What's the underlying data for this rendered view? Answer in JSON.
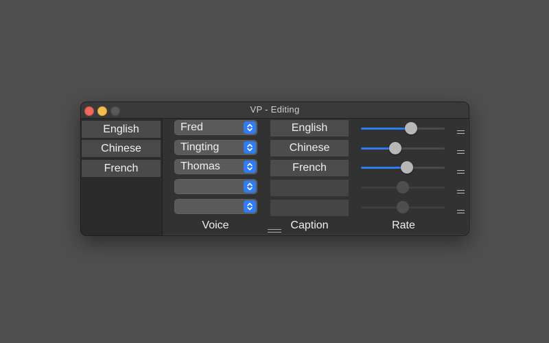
{
  "window": {
    "title": "VP  -  Editing"
  },
  "languages": [
    {
      "label": "English"
    },
    {
      "label": "Chinese"
    },
    {
      "label": "French"
    }
  ],
  "toolbar": {
    "icons": [
      "grid-icon",
      "speaker-icon",
      "gear-icon",
      "help-icon",
      "chevron-left-icon"
    ]
  },
  "rows": [
    {
      "voice": "Fred",
      "caption": "English",
      "rate": 0.6,
      "enabled": true
    },
    {
      "voice": "Tingting",
      "caption": "Chinese",
      "rate": 0.41,
      "enabled": true
    },
    {
      "voice": "Thomas",
      "caption": "French",
      "rate": 0.55,
      "enabled": true
    },
    {
      "voice": "",
      "caption": "",
      "rate": 0.5,
      "enabled": false
    },
    {
      "voice": "",
      "caption": "",
      "rate": 0.5,
      "enabled": false
    }
  ],
  "headers": {
    "voice": "Voice",
    "caption": "Caption",
    "rate": "Rate"
  },
  "colors": {
    "accent": "#2f7cf6",
    "close": "#ed6a5e",
    "minimize": "#f4be4f"
  }
}
